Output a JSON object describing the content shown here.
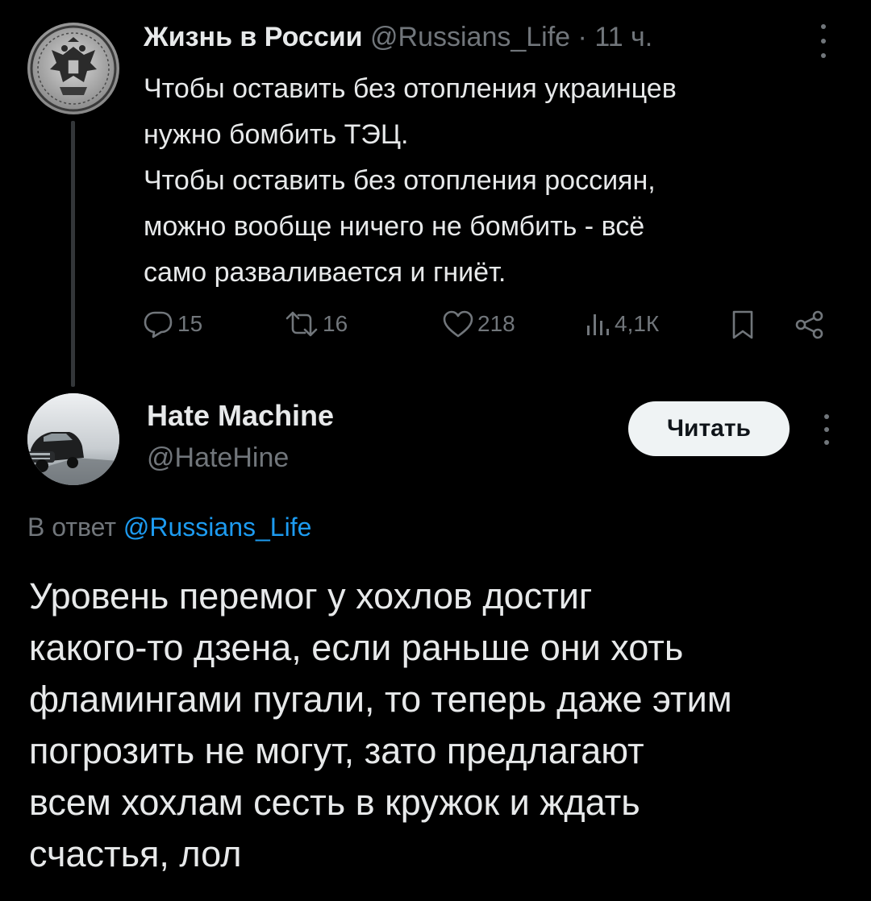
{
  "parent_tweet": {
    "author_name": "Жизнь в России",
    "handle": "@Russians_Life",
    "separator": "·",
    "time": "11 ч.",
    "text_lines": [
      "Чтобы оставить без отопления украинцев",
      "нужно бомбить ТЭЦ.",
      "Чтобы оставить без отопления россиян,",
      "можно вообще ничего не бомбить - всё",
      "само разваливается и гниёт."
    ],
    "stats": {
      "replies": "15",
      "retweets": "16",
      "likes": "218",
      "views": "4,1К"
    },
    "icons": {
      "reply": "reply-icon",
      "retweet": "retweet-icon",
      "like": "heart-icon",
      "views": "views-icon",
      "bookmark": "bookmark-icon",
      "share": "share-icon",
      "more": "more-vertical-icon"
    }
  },
  "reply_tweet": {
    "author_name": "Hate Machine",
    "handle": "@HateHine",
    "follow_button_label": "Читать",
    "reply_to_prefix": "В ответ",
    "reply_to_handle": "@Russians_Life",
    "text_lines": [
      "Уровень перемог у хохлов достиг",
      "какого-то дзена, если раньше они хоть",
      "фламингами пугали, то теперь даже этим",
      "погрозить не могут, зато предлагают",
      "всем хохлам сесть в кружок и ждать",
      "счастья, лол"
    ]
  },
  "colors": {
    "background": "#000000",
    "text_primary": "#e7e9ea",
    "text_secondary": "#71767b",
    "link": "#1d9bf0",
    "button_bg": "#eff3f4"
  }
}
